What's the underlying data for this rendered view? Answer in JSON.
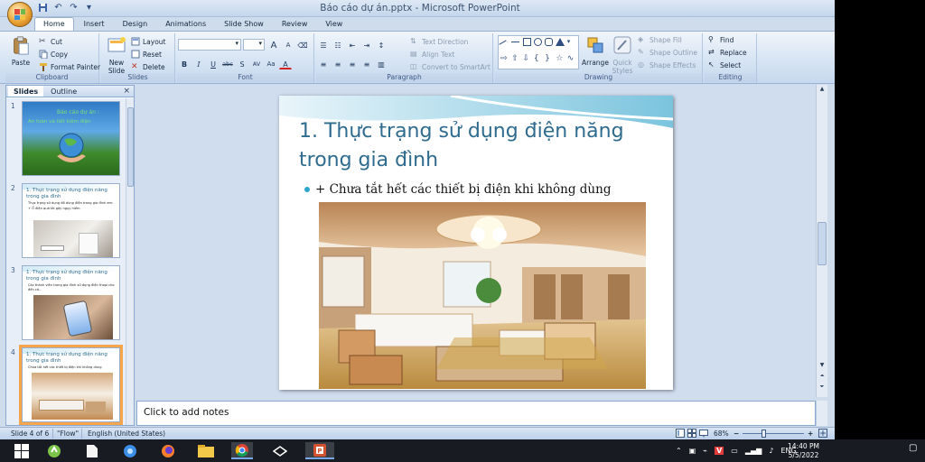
{
  "window": {
    "title": "Báo cáo dự án.pptx - Microsoft PowerPoint",
    "controls": {
      "minimize": "–",
      "restore": "❐",
      "close": "✕"
    }
  },
  "ribbon": {
    "tabs": [
      {
        "label": "Home",
        "active": true
      },
      {
        "label": "Insert"
      },
      {
        "label": "Design"
      },
      {
        "label": "Animations"
      },
      {
        "label": "Slide Show"
      },
      {
        "label": "Review"
      },
      {
        "label": "View"
      }
    ],
    "clipboard": {
      "label": "Clipboard",
      "paste": "Paste",
      "cut": "Cut",
      "copy": "Copy",
      "format_painter": "Format Painter"
    },
    "slides": {
      "label": "Slides",
      "new_slide_1": "New",
      "new_slide_2": "Slide",
      "layout": "Layout",
      "reset": "Reset",
      "delete": "Delete"
    },
    "font": {
      "label": "Font",
      "bold": "B",
      "italic": "I",
      "underline": "U",
      "strike": "abc",
      "shadow": "S",
      "spacing": "AV",
      "case": "Aa",
      "color": "A",
      "grow": "A",
      "shrink": "A"
    },
    "paragraph": {
      "label": "Paragraph",
      "text_direction": "Text Direction",
      "align_text": "Align Text",
      "convert_smartart": "Convert to SmartArt"
    },
    "drawing": {
      "label": "Drawing",
      "arrange": "Arrange",
      "quick_styles_1": "Quick",
      "quick_styles_2": "Styles",
      "shape_fill": "Shape Fill",
      "shape_outline": "Shape Outline",
      "shape_effects": "Shape Effects"
    },
    "editing": {
      "label": "Editing",
      "find": "Find",
      "replace": "Replace",
      "select": "Select"
    }
  },
  "left_panel": {
    "tabs": [
      {
        "label": "Slides",
        "active": true
      },
      {
        "label": "Outline"
      }
    ],
    "close": "×",
    "slides": [
      {
        "num": "1",
        "title": "Báo cáo dự án :",
        "subtitle": "An toàn và tiết kiệm điện"
      },
      {
        "num": "2",
        "title": "1. Thực trạng sử dụng điện năng trong gia đình",
        "bullets": [
          "Thực trạng sử dụng đồ dùng điện trong gia đình em:",
          "+ Ổ điện quá tải gây ngụy hiểm"
        ]
      },
      {
        "num": "3",
        "title": "1. Thực trạng sử dụng điện năng trong gia đình",
        "bullets": [
          "Các thành viên trong gia đình sử dụng điện thoại cho đến cả..."
        ]
      },
      {
        "num": "4",
        "title": "1. Thực trạng sử dụng điện năng trong gia đình",
        "bullets": [
          "Chưa tắt hết các thiết bị điện khi không dùng"
        ]
      }
    ]
  },
  "slide": {
    "title": "1. Thực trạng sử dụng điện năng trong gia đình",
    "bullet": "+ Chưa tắt hết các thiết bị điện khi không dùng"
  },
  "notes": {
    "placeholder": "Click to add notes"
  },
  "status_bar": {
    "slide_info": "Slide 4 of 6",
    "theme": "\"Flow\"",
    "language": "English (United States)",
    "zoom": "68%",
    "zoom_out": "−",
    "zoom_in": "+"
  },
  "taskbar": {
    "tray": {
      "language": "ENG",
      "time": "14:40 PM",
      "date": "5/5/2022"
    }
  },
  "colors": {
    "accent": "#f6a54a",
    "title_blue": "#2e6b8e",
    "bullet_cyan": "#2aa8cc"
  }
}
